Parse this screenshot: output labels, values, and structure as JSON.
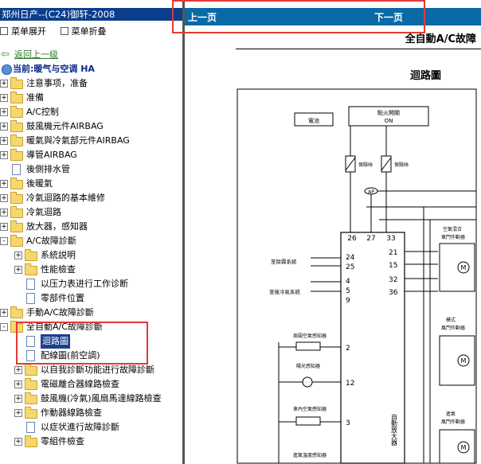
{
  "left_panel": {
    "title": "郑州日产--(C24)御轩-2008",
    "toolbar": {
      "expand_label": "菜单展开",
      "collapse_label": "菜单折叠"
    },
    "back_label": "返回上一级",
    "current_label": "当前:暖气与空调 HA",
    "tree": [
      {
        "label": "注意事项，准备",
        "level": 0,
        "type": "folder",
        "expander": "+"
      },
      {
        "label": "准備",
        "level": 0,
        "type": "folder",
        "expander": "+"
      },
      {
        "label": "A/C控制",
        "level": 0,
        "type": "folder",
        "expander": "+"
      },
      {
        "label": "鼓風機元件AIRBAG",
        "level": 0,
        "type": "folder",
        "expander": "+"
      },
      {
        "label": "暖氣與冷氣部元件AIRBAG",
        "level": 0,
        "type": "folder",
        "expander": "+"
      },
      {
        "label": "導管AIRBAG",
        "level": 0,
        "type": "folder",
        "expander": "+"
      },
      {
        "label": "後側排水管",
        "level": 0,
        "type": "doc",
        "expander": ""
      },
      {
        "label": "後暖氣",
        "level": 0,
        "type": "folder",
        "expander": "+"
      },
      {
        "label": "冷氣迴路的基本維修",
        "level": 0,
        "type": "folder",
        "expander": "+"
      },
      {
        "label": "冷氣迴路",
        "level": 0,
        "type": "folder",
        "expander": "+"
      },
      {
        "label": "放大器，感知器",
        "level": 0,
        "type": "folder",
        "expander": "+"
      },
      {
        "label": "A/C故障診斷",
        "level": 0,
        "type": "folder",
        "expander": "-"
      },
      {
        "label": "系統説明",
        "level": 1,
        "type": "folder",
        "expander": "+"
      },
      {
        "label": "性能檢查",
        "level": 1,
        "type": "folder",
        "expander": "+"
      },
      {
        "label": "以压力表进行工作诊断",
        "level": 1,
        "type": "doc",
        "expander": ""
      },
      {
        "label": "零部件位置",
        "level": 1,
        "type": "doc",
        "expander": ""
      },
      {
        "label": "手動A/C故障診斷",
        "level": 0,
        "type": "folder",
        "expander": "+"
      },
      {
        "label": "全自動A/C故障診斷",
        "level": 0,
        "type": "folder",
        "expander": "-"
      },
      {
        "label": "迴路圖",
        "level": 1,
        "type": "doc",
        "expander": "",
        "selected": true
      },
      {
        "label": "配線圖(前空調)",
        "level": 1,
        "type": "doc",
        "expander": ""
      },
      {
        "label": "以自我診斷功能进行故障診斷",
        "level": 1,
        "type": "folder",
        "expander": "+"
      },
      {
        "label": "電磁離合器線路檢查",
        "level": 1,
        "type": "folder",
        "expander": "+"
      },
      {
        "label": "鼓風機(冷氣)風扇馬達線路檢查",
        "level": 1,
        "type": "folder",
        "expander": "+"
      },
      {
        "label": "作動器線路檢查",
        "level": 1,
        "type": "folder",
        "expander": "+"
      },
      {
        "label": "以症状進行故障診斷",
        "level": 1,
        "type": "doc",
        "expander": ""
      },
      {
        "label": "零組件檢查",
        "level": 1,
        "type": "folder",
        "expander": "+"
      }
    ]
  },
  "right_panel": {
    "nav": {
      "prev_label": "上一页",
      "next_label": "下一页"
    },
    "doc_title": "全自動A/C故障",
    "diagram_title": "迴路圖",
    "diagram": {
      "battery": "電池",
      "ignition_switch": "點火開關",
      "ignition_state": "ON",
      "fuse1": "保險絲",
      "fuse2": "保險絲",
      "ap_tag": "AP",
      "connector_top": [
        "26",
        "27",
        "33"
      ],
      "pins_left": [
        "24",
        "25",
        "4",
        "5",
        "9",
        "2",
        "12",
        "3"
      ],
      "pins_right": [
        "21",
        "15",
        "32",
        "36"
      ],
      "to_defrost": "至除霧系統",
      "to_rear_ac": "至後冷氣系統",
      "ambient_sensor": "周圍空氣感知器",
      "sunload_sensor": "陽光感知器",
      "incar_sensor": "車內空氣感知器",
      "intake_temp_sensor": "進氣溫度感知器",
      "mix_actuator_1": "空氣混合",
      "mix_actuator_2": "車門作動器",
      "mode_actuator_1": "模式",
      "mode_actuator_2": "風門作動器",
      "intake_actuator_1": "進氣",
      "intake_actuator_2": "風門作動器",
      "amp_label": "自動放大器"
    }
  }
}
